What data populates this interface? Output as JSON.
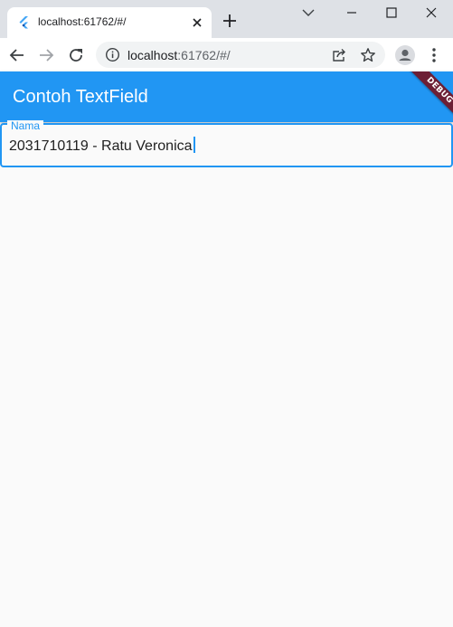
{
  "browser": {
    "tab": {
      "title": "localhost:61762/#/",
      "favicon": "flutter-icon"
    },
    "url": {
      "host": "localhost",
      "path": ":61762/#/"
    },
    "icons": {
      "back": "arrow-left-icon",
      "forward": "arrow-right-icon",
      "reload": "reload-icon",
      "info": "info-icon",
      "share": "share-icon",
      "bookmark": "star-icon",
      "profile": "account-icon",
      "menu": "kebab-menu-icon"
    }
  },
  "app": {
    "title": "Contoh TextField",
    "debug_banner": "DEBUG",
    "textfield": {
      "label": "Nama",
      "value": "2031710119 - Ratu Veronica"
    }
  },
  "colors": {
    "primary": "#2196f3",
    "debug_banner": "#6d1f35",
    "background": "#fafafa",
    "tabstrip": "#dee1e6"
  }
}
